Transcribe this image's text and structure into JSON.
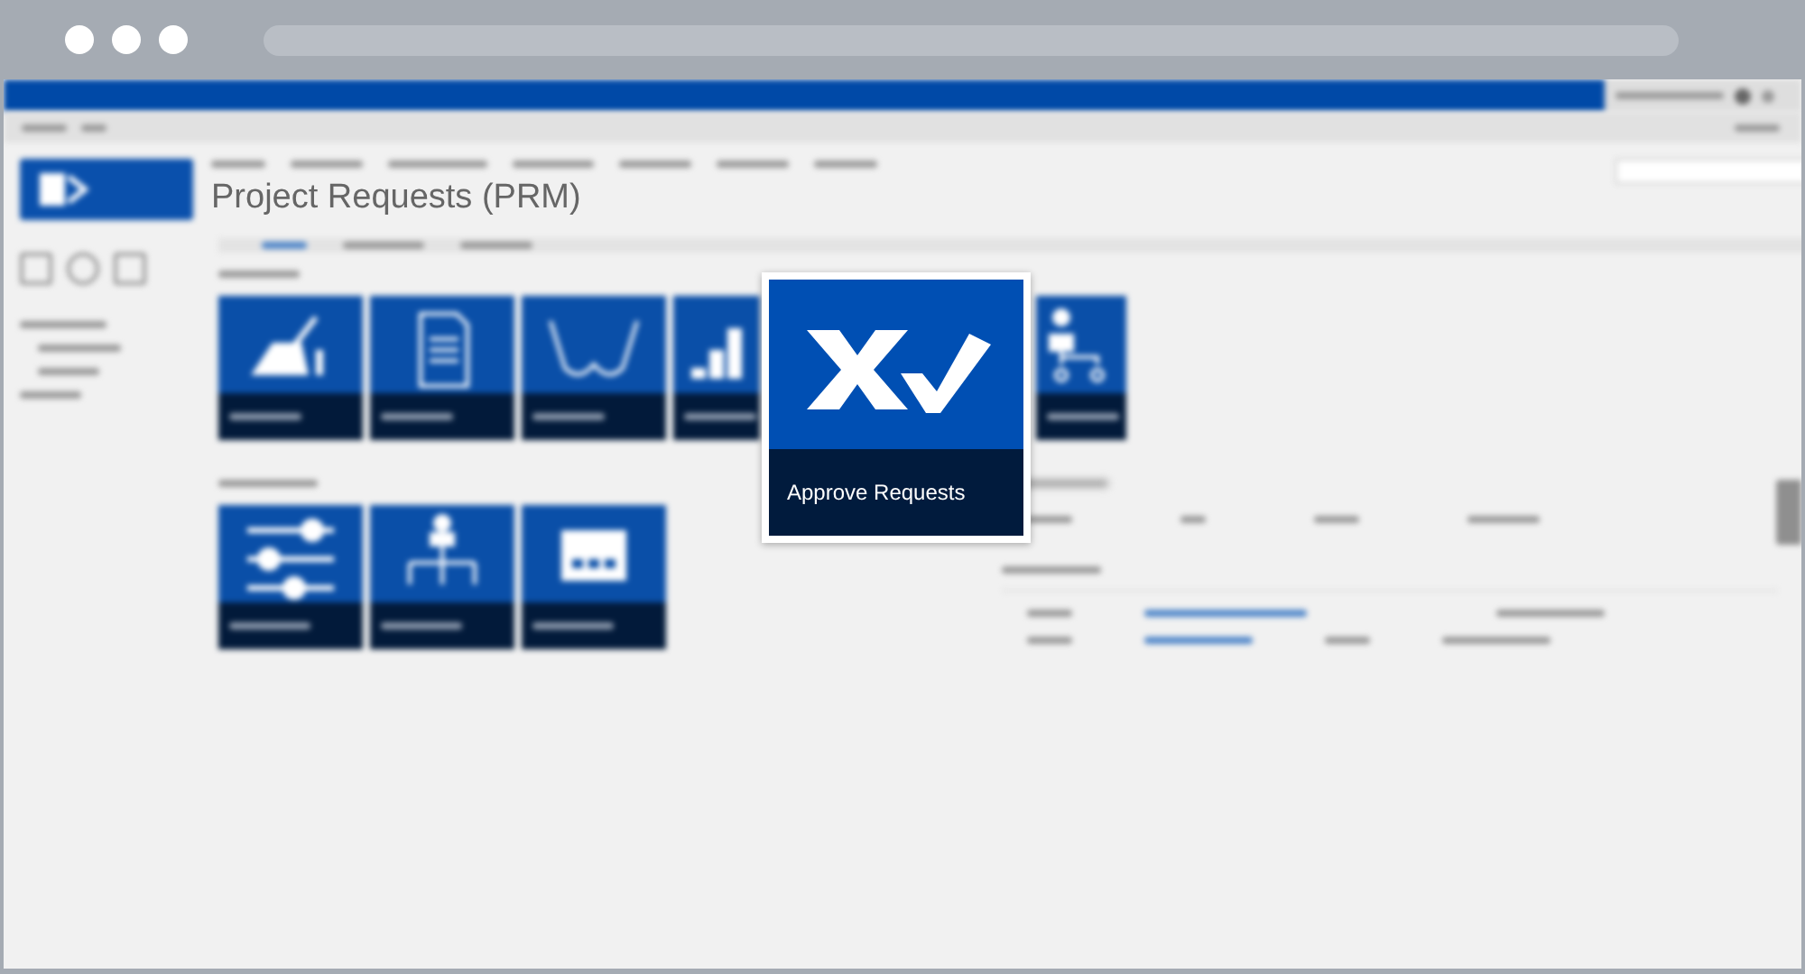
{
  "page": {
    "title": "Project Requests (PRM)"
  },
  "highlight_tile": {
    "label": "Approve Requests"
  }
}
